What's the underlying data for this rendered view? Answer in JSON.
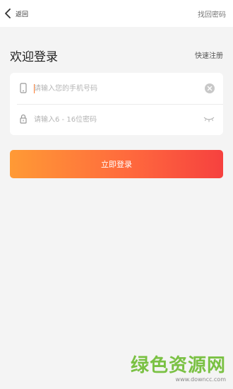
{
  "header": {
    "back_label": "返回",
    "forgot_password": "找回密码"
  },
  "main": {
    "welcome_title": "欢迎登录",
    "quick_register": "快速注册"
  },
  "form": {
    "phone_placeholder": "请输入您的手机号码",
    "phone_value": "",
    "password_placeholder": "请输入6 - 16位密码",
    "password_value": ""
  },
  "actions": {
    "login_label": "立即登录"
  },
  "watermark": {
    "main": "绿色资源网",
    "url": "www.downcc.com"
  },
  "icons": {
    "back": "chevron-left-icon",
    "phone": "phone-icon",
    "lock": "lock-icon",
    "clear": "clear-icon",
    "eye": "eye-closed-icon"
  },
  "colors": {
    "accent_caret": "#ff7a2d",
    "button_gradient_start": "#ff9a35",
    "button_gradient_end": "#f6413f",
    "watermark_green": "#7ac143"
  }
}
